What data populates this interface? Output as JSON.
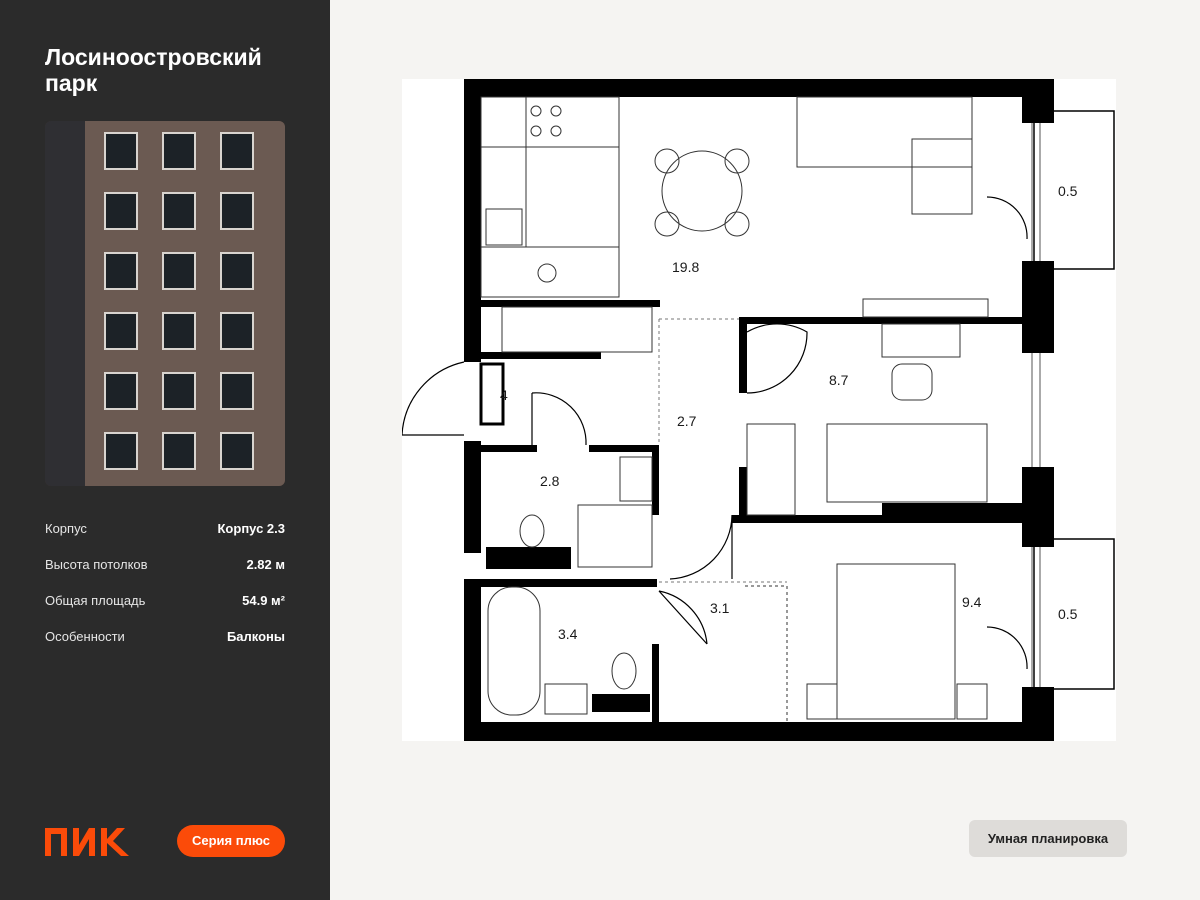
{
  "sidebar": {
    "complex_title": "Лосиноостровский парк",
    "info": [
      {
        "label": "Корпус",
        "value": "Корпус 2.3"
      },
      {
        "label": "Высота потолков",
        "value": "2.82 м"
      },
      {
        "label": "Общая площадь",
        "value": "54.9 м²"
      },
      {
        "label": "Особенности",
        "value": "Балконы"
      }
    ],
    "logo_text": "ПИК",
    "series_button": "Серия плюс"
  },
  "plan": {
    "rooms": {
      "kitchen_living": "19.8",
      "hall": "4",
      "bathroom_small": "2.8",
      "corridor": "2.7",
      "bedroom_1": "8.7",
      "bathroom": "3.4",
      "closet": "3.1",
      "bedroom_2": "9.4",
      "balcony_1": "0.5",
      "balcony_2": "0.5"
    }
  },
  "smart_button": "Умная планировка",
  "colors": {
    "sidebar_bg": "#2b2b2b",
    "accent": "#fb4b09",
    "page_bg": "#f5f4f2",
    "wall": "#000000"
  }
}
